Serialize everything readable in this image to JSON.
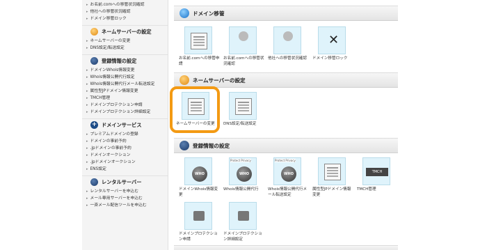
{
  "sidebar": {
    "top_items": [
      "お名前.comへの移管状況確認",
      "他社への移管状況確認",
      "ドメイン移管ロック"
    ],
    "sections": [
      {
        "title": "ネームサーバーの設定",
        "icon": "globe-icon",
        "items": [
          "ネームサーバーの変更",
          "DNS設定/転送設定"
        ]
      },
      {
        "title": "登録情報の設定",
        "icon": "registration-icon",
        "items": [
          "ドメインWhois情報変更",
          "Whois情報公開代行設定",
          "Whois情報公開代行メール転送設定",
          "属性型JPドメイン情報変更",
          "TMCH管理",
          "ドメインプロテクション申請",
          "ドメインプロテクション詳細設定"
        ]
      },
      {
        "title": "ドメインサービス",
        "icon": "plus-icon",
        "items": [
          "プレミアムドメインの登録",
          "ドメインの事前予約",
          ".jpドメインの事前予約",
          "ドメインオークション",
          ".jpドメインオークション",
          "ENS設定"
        ]
      },
      {
        "title": "レンタルサーバー",
        "icon": "server-icon",
        "items": [
          "レンタルサーバーを申込む",
          "メール専用サーバーを申込む",
          "一斉メール配信ツールを申込む"
        ]
      }
    ]
  },
  "main": {
    "sections": [
      {
        "title": "ドメイン移管",
        "tiles": [
          "お名前.comへの移管申請",
          "お名前.comへの移管状況確認",
          "他社への移管状況確認",
          "ドメイン移管ロック"
        ]
      },
      {
        "title": "ネームサーバーの設定",
        "tiles": [
          "ネームサーバーの変更",
          "DNS設定/転送設定"
        ]
      },
      {
        "title": "登録情報の設定",
        "tiles": [
          "ドメインWhois情報変更",
          "Whois情報公開代行",
          "Whois情報公開代行メール転送設定",
          "属性型JPドメイン情報変更",
          "TMCH管理",
          "ドメインプロテクション申請",
          "ドメインプロテクション詳細設定"
        ]
      }
    ],
    "icon_tags": {
      "protect": "Protect Privacy",
      "who": "WHO",
      "tmch": "TMCH"
    }
  },
  "colors": {
    "highlight": "#f39a13",
    "tile_bg": "#dff3fb"
  }
}
